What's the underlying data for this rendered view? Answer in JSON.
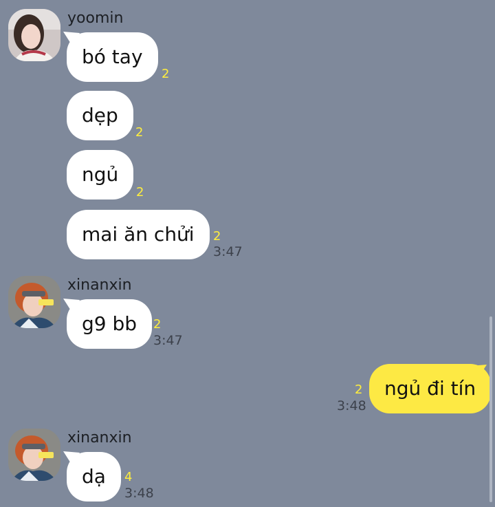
{
  "colors": {
    "background": "#7f899b",
    "bubble_other": "#ffffff",
    "bubble_mine": "#fde944",
    "unread": "#ffee3d"
  },
  "messages": [
    {
      "sender": "yoomin",
      "avatar_icon": "profile-photo-icon",
      "bubbles": [
        {
          "text": "bó tay",
          "unread": "2"
        },
        {
          "text": "dẹp",
          "unread": "2"
        },
        {
          "text": "ngủ",
          "unread": "2"
        },
        {
          "text": "mai ăn chửi",
          "unread": "2",
          "time": "3:47"
        }
      ]
    },
    {
      "sender": "xinanxin",
      "avatar_icon": "profile-photo-icon",
      "bubbles": [
        {
          "text": "g9 bb",
          "unread": "2",
          "time": "3:47"
        }
      ]
    },
    {
      "sender": "me",
      "bubbles": [
        {
          "text": "ngủ đi tín",
          "unread": "2",
          "time": "3:48"
        }
      ]
    },
    {
      "sender": "xinanxin",
      "avatar_icon": "profile-photo-icon",
      "bubbles": [
        {
          "text": "dạ",
          "unread": "4",
          "time": "3:48"
        }
      ]
    }
  ]
}
